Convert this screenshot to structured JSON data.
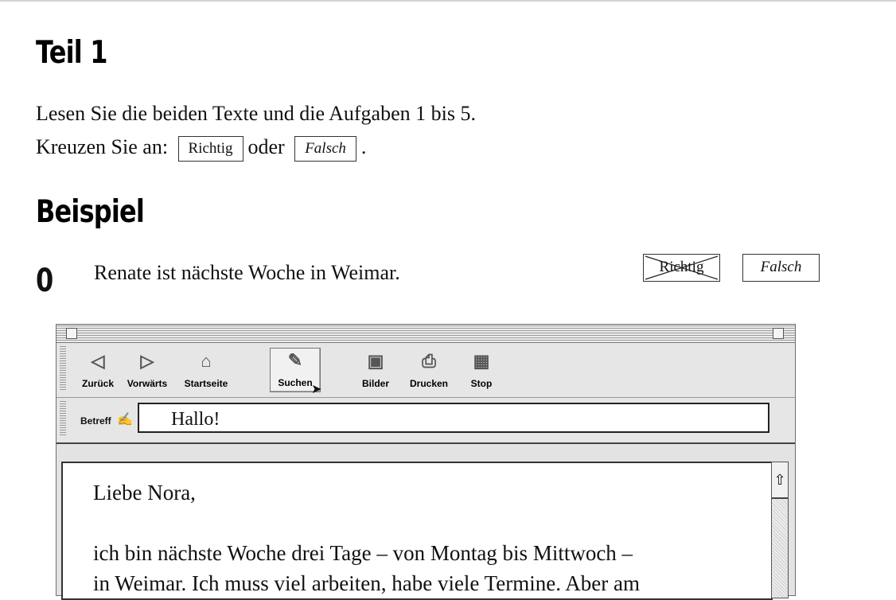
{
  "section_title": "Teil 1",
  "instructions": {
    "line1": "Lesen Sie die beiden Texte und die Aufgaben 1 bis 5.",
    "line2_prefix": "Kreuzen Sie an:",
    "richtig": "Richtig",
    "oder": "oder",
    "falsch": "Falsch",
    "period": "."
  },
  "example": {
    "heading": "Beispiel",
    "number": "0",
    "statement": "Renate ist nächste Woche in Weimar.",
    "option_richtig": "Richtig",
    "option_falsch": "Falsch",
    "selected": "Richtig"
  },
  "browser": {
    "toolbar": [
      {
        "label": "Zurück",
        "icon": "back-icon"
      },
      {
        "label": "Vorwärts",
        "icon": "forward-icon"
      },
      {
        "label": "Startseite",
        "icon": "home-icon"
      },
      {
        "label": "Suchen",
        "icon": "search-icon"
      },
      {
        "label": "Bilder",
        "icon": "image-icon"
      },
      {
        "label": "Drucken",
        "icon": "print-icon"
      },
      {
        "label": "Stop",
        "icon": "stop-icon"
      }
    ],
    "subject_label": "Betreff",
    "subject_value": "Hallo!",
    "email": {
      "greeting": "Liebe Nora,",
      "line1": "ich bin nächste Woche drei Tage – von Montag bis Mittwoch –",
      "line2": "in Weimar. Ich muss viel arbeiten, habe viele Termine. Aber am"
    }
  }
}
